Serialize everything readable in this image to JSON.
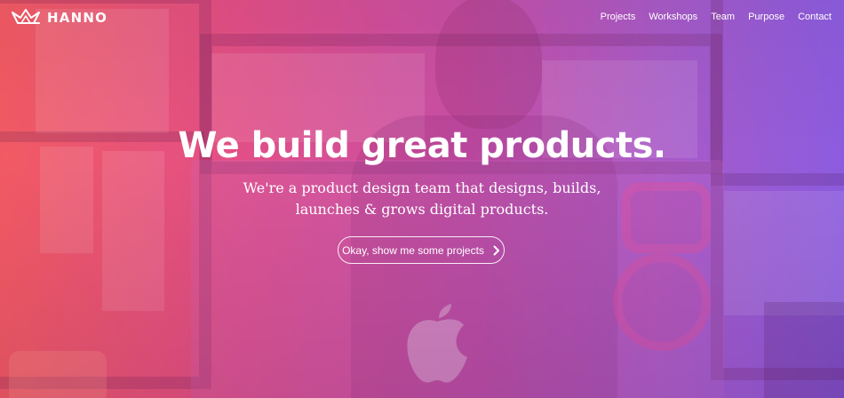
{
  "brand": {
    "name": "HANNO",
    "logo_icon": "crown-icon"
  },
  "nav": {
    "items": [
      {
        "label": "Projects"
      },
      {
        "label": "Workshops"
      },
      {
        "label": "Team"
      },
      {
        "label": "Purpose"
      },
      {
        "label": "Contact"
      }
    ]
  },
  "hero": {
    "headline": "We build great products.",
    "subhead_line1": "We're a product design team that designs, builds,",
    "subhead_line2": "launches & grows digital products.",
    "cta_label": "Okay, show me some projects",
    "cta_icon": "chevron-right-icon"
  },
  "colors": {
    "gradient_start": "#f25a63",
    "gradient_mid": "#c84fa6",
    "gradient_end": "#8c5ce0",
    "text": "#ffffff"
  }
}
